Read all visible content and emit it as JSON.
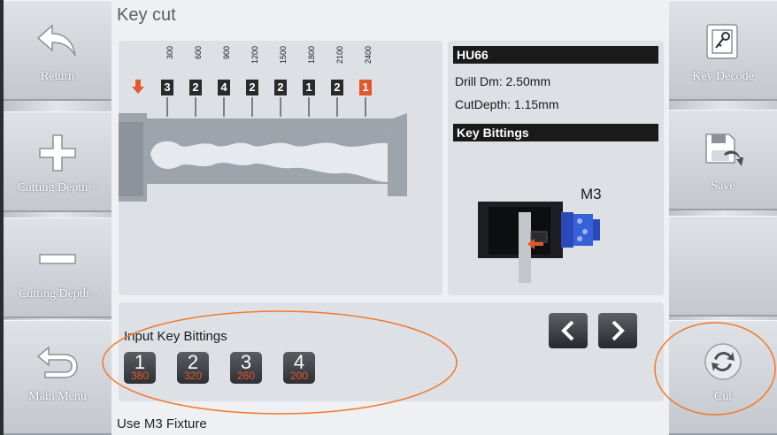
{
  "screen": {
    "title": "Key cut",
    "footer_hint": "Use M3 Fixture"
  },
  "left_sidebar": {
    "return_label": "Return",
    "depth_plus_label": "Cutting Depth +",
    "depth_minus_label": "Cutting Depth -",
    "main_menu_label": "Main Menu"
  },
  "right_sidebar": {
    "key_decode_label": "Key Decode",
    "save_label": "Save",
    "cut_label": "Cut"
  },
  "key_diagram": {
    "depth_scale": [
      "300",
      "600",
      "900",
      "1200",
      "1500",
      "1800",
      "2100",
      "2400"
    ],
    "cut_values": [
      "3",
      "2",
      "4",
      "2",
      "2",
      "1",
      "2",
      "1"
    ],
    "active_index": 7
  },
  "key_info": {
    "key_model": "HU66",
    "drill_label": "Drill Dm: 2.50mm",
    "cut_depth_label": "CutDepth: 1.15mm",
    "bittings_header": "Key Bittings",
    "fixture_label": "M3"
  },
  "input_panel": {
    "label": "Input Key Bittings",
    "bittings": [
      {
        "number": "1",
        "depth": "380"
      },
      {
        "number": "2",
        "depth": "320"
      },
      {
        "number": "3",
        "depth": "260"
      },
      {
        "number": "4",
        "depth": "200"
      }
    ]
  },
  "colors": {
    "accent_orange": "#e2582b",
    "annotation_circle": "#f07a2a",
    "dark_box": "#2a2a2a"
  }
}
